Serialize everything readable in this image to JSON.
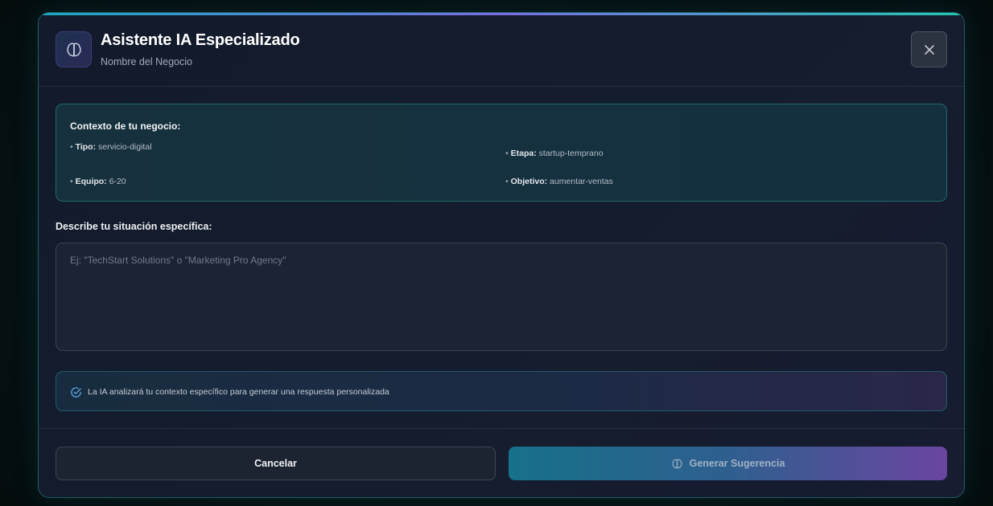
{
  "header": {
    "title": "Asistente IA Especializado",
    "subtitle": "Nombre del Negocio",
    "icon": "brain-icon",
    "close_icon": "close-icon"
  },
  "context": {
    "title": "Contexto de tu negocio:",
    "bullet": "•",
    "items": [
      {
        "key": "Tipo:",
        "value": "servicio-digital"
      },
      {
        "key": "Etapa:",
        "value": "startup-temprano"
      },
      {
        "key": "Equipo:",
        "value": "6-20"
      },
      {
        "key": "Objetivo:",
        "value": "aumentar-ventas"
      }
    ]
  },
  "situation": {
    "label": "Describe tu situación específica:",
    "value": "",
    "placeholder": "Ej: \"TechStart Solutions\" o \"Marketing Pro Agency\""
  },
  "info": {
    "icon": "check-circle-icon",
    "text": "La IA analizará tu contexto específico para generar una respuesta personalizada"
  },
  "footer": {
    "cancel_label": "Cancelar",
    "generate_label": "Generar Sugerencia",
    "generate_icon": "brain-icon"
  },
  "colors": {
    "accent_teal": "#1aa8c0",
    "accent_purple": "#6a45a0",
    "border_teal": "#1f6a6a"
  }
}
